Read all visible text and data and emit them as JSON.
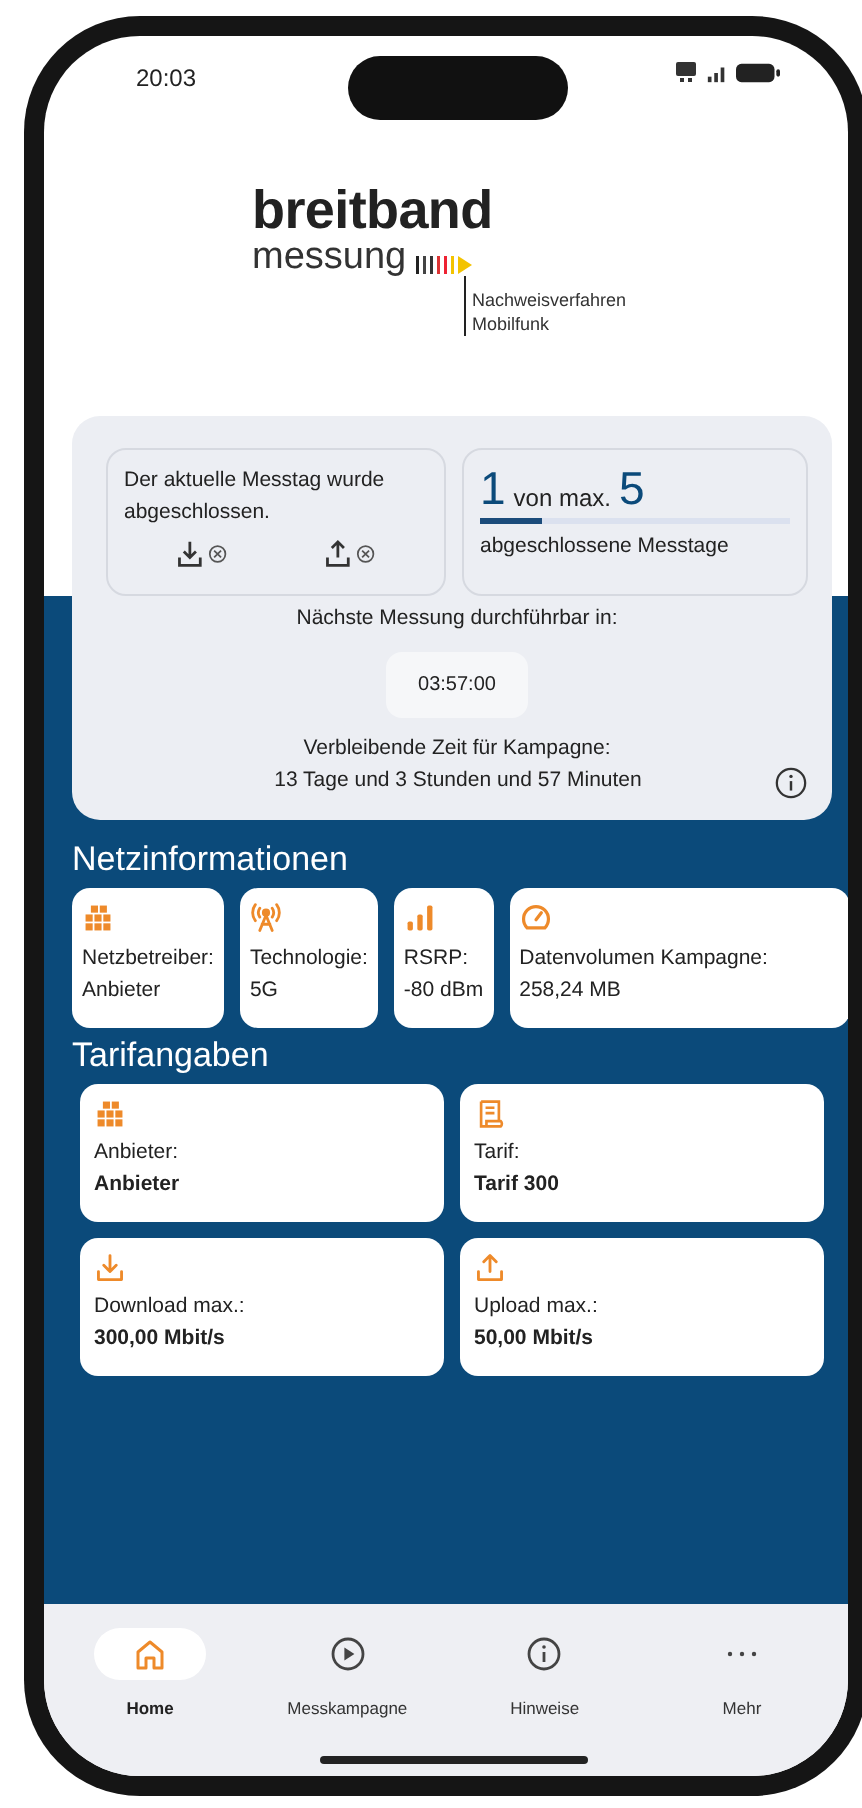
{
  "status_bar": {
    "time": "20:03"
  },
  "logo": {
    "title": "breitband",
    "subtitle": "messung",
    "tagline_1": "Nachweisverfahren",
    "tagline_2": "Mobilfunk"
  },
  "status_card": {
    "message": "Der aktuelle Messtag wurde abgeschlossen.",
    "count": "1",
    "of_label": "von max.",
    "max": "5",
    "level": 0.2,
    "caption": "abgeschlossene Messtage",
    "next_label": "Nächste Messung durchführbar in:",
    "countdown": "03:57:00",
    "remaining_label": "Verbleibende Zeit für Kampagne:",
    "remaining": "13 Tage und 3 Stunden und 57 Minuten"
  },
  "network_info": {
    "title": "Netzinformationen",
    "items": [
      {
        "kind": "building",
        "label": "Netzbetreiber:",
        "value": "Anbieter"
      },
      {
        "kind": "antenna",
        "label": "Technologie:",
        "value": "5G"
      },
      {
        "kind": "signal",
        "label": "RSRP:",
        "value": "-80 dBm"
      },
      {
        "kind": "gauge",
        "label": "Datenvolumen Kampagne:",
        "value": "258,24 MB"
      }
    ]
  },
  "tariff": {
    "title": "Tarifangaben",
    "items": [
      {
        "kind": "building",
        "label": "Anbieter:",
        "value": "Anbieter"
      },
      {
        "kind": "receipt",
        "label": "Tarif:",
        "value": "Tarif 300"
      },
      {
        "kind": "download",
        "label": "Download max.:",
        "value": "300,00 Mbit/s"
      },
      {
        "kind": "upload",
        "label": "Upload max.:",
        "value": "50,00 Mbit/s"
      }
    ]
  },
  "nav": [
    {
      "kind": "home",
      "label": "Home",
      "selected": true
    },
    {
      "kind": "play",
      "label": "Messkampagne",
      "selected": false
    },
    {
      "kind": "info",
      "label": "Hinweise",
      "selected": false
    },
    {
      "kind": "more",
      "label": "Mehr",
      "selected": false
    }
  ]
}
